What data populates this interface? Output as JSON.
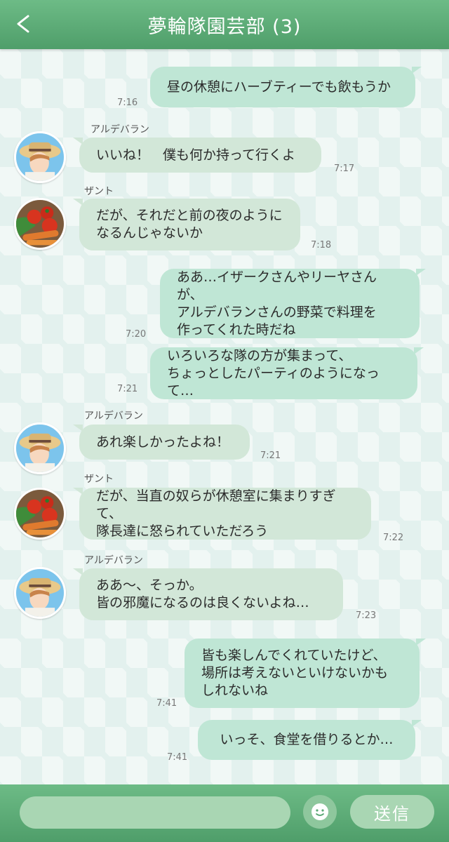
{
  "header": {
    "back_icon": "chevron-left-icon",
    "title": "夢輪隊園芸部 (3)"
  },
  "messages": [
    {
      "side": "right",
      "text": "昼の休憩にハーブティーでも飲もうか",
      "time": "7:16"
    },
    {
      "side": "left",
      "sender": "アルデバラン",
      "avatar": "aldebaran",
      "text": "いいね！　僕も何か持って行くよ",
      "time": "7:17"
    },
    {
      "side": "left",
      "sender": "ザント",
      "avatar": "zant",
      "text": "だが、それだと前の夜のように\nなるんじゃないか",
      "time": "7:18"
    },
    {
      "side": "right",
      "text": "ああ…イザークさんやリーヤさんが、\nアルデバランさんの野菜で料理を\n作ってくれた時だね",
      "time": "7:20"
    },
    {
      "side": "right",
      "text": "いろいろな隊の方が集まって、\nちょっとしたパーティのようになって…",
      "time": "7:21"
    },
    {
      "side": "left",
      "sender": "アルデバラン",
      "avatar": "aldebaran",
      "text": "あれ楽しかったよね！",
      "time": "7:21"
    },
    {
      "side": "left",
      "sender": "ザント",
      "avatar": "zant",
      "text": "だが、当直の奴らが休憩室に集まりすぎて、\n隊長達に怒られていただろう",
      "time": "7:22"
    },
    {
      "side": "left",
      "sender": "アルデバラン",
      "avatar": "aldebaran",
      "text": "ああ〜、そっか。\n皆の邪魔になるのは良くないよね…",
      "time": "7:23"
    },
    {
      "side": "right",
      "text": "皆も楽しんでくれていたけど、\n場所は考えないといけないかも\nしれないね",
      "time": "7:41"
    },
    {
      "side": "right",
      "text": "いっそ、食堂を借りるとか…",
      "time": "7:41"
    }
  ],
  "footer": {
    "input_placeholder": "",
    "emoji_icon": "smiley-icon",
    "send_label": "送信"
  },
  "colors": {
    "header": "#5aa874",
    "bubble_right": "#bfe6d5",
    "bubble_left": "#d2e7d8"
  }
}
